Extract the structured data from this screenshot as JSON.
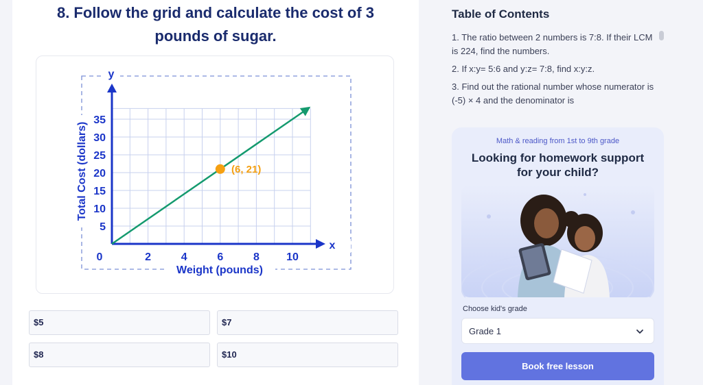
{
  "question": {
    "title_line1": "8. Follow the grid and calculate the cost of 3",
    "title_line2": "pounds of sugar."
  },
  "graph": {
    "y_axis_letter": "y",
    "x_axis_letter": "x",
    "ylabel": "Total Cost (dollars)",
    "xlabel": "Weight (pounds)",
    "origin_label": "0",
    "y_ticks": [
      "5",
      "10",
      "15",
      "20",
      "25",
      "30",
      "35"
    ],
    "x_ticks": [
      "2",
      "4",
      "6",
      "8",
      "10"
    ],
    "point_label": "(6, 21)"
  },
  "chart_data": {
    "type": "line",
    "xlabel": "Weight (pounds)",
    "ylabel": "Total Cost (dollars)",
    "xlim": [
      0,
      11
    ],
    "ylim": [
      0,
      38
    ],
    "series": [
      {
        "x": [
          0,
          11
        ],
        "y": [
          0,
          38.5
        ]
      }
    ],
    "highlight_point": {
      "x": 6,
      "y": 21,
      "label": "(6, 21)"
    },
    "grid": true
  },
  "options": [
    {
      "label": "$5"
    },
    {
      "label": "$7"
    },
    {
      "label": "$8"
    },
    {
      "label": "$10"
    }
  ],
  "toc": {
    "title": "Table of Contents",
    "items": [
      "1. The ratio between 2 numbers is 7:8. If their LCM is 224, find the numbers.",
      "2. If x:y= 5:6 and y:z= 7:8, find x:y:z.",
      "3. Find out the rational number whose numerator is (-5) × 4 and the denominator is"
    ]
  },
  "promo": {
    "subtitle": "Math & reading from 1st to 9th grade",
    "headline_line1": "Looking for homework support",
    "headline_line2": "for your child?",
    "grade_label": "Choose kid's grade",
    "grade_value": "Grade 1",
    "button": "Book free lesson"
  },
  "colors": {
    "title": "#1a2b6d",
    "axis": "#1a35c8",
    "line": "#149a6e",
    "point": "#f5a012",
    "button": "#6173e0"
  }
}
